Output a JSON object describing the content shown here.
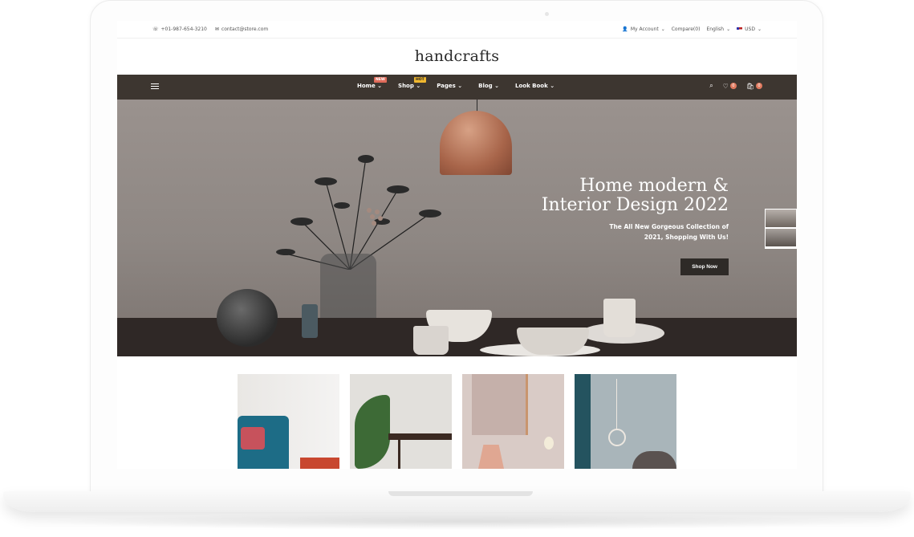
{
  "topbar": {
    "phone": "+01-987-654-3210",
    "email": "contact@store.com",
    "account": "My Account",
    "compare": "Compare(0)",
    "language": "English",
    "currency": "USD"
  },
  "logo": "handcrafts",
  "nav": {
    "items": [
      {
        "label": "Home",
        "badge": "NEW"
      },
      {
        "label": "Shop",
        "badge": "HOT"
      },
      {
        "label": "Pages",
        "badge": ""
      },
      {
        "label": "Blog",
        "badge": ""
      },
      {
        "label": "Look Book",
        "badge": ""
      }
    ],
    "wishlist_count": "0",
    "cart_count": "0"
  },
  "hero": {
    "title_line1": "Home modern &",
    "title_line2": "Interior Design 2022",
    "subtitle_line1": "The All New Gorgeous Collection of",
    "subtitle_line2": "2021, Shopping With Us!",
    "button": "Shop Now"
  },
  "icons": {
    "phone": "phone-icon",
    "email": "envelope-icon",
    "account": "user-icon",
    "menu": "hamburger-icon",
    "search": "search-icon",
    "wishlist": "heart-icon",
    "cart": "bag-icon"
  },
  "colors": {
    "nav_bg": "#3d3630",
    "badge_new": "#e06b5a",
    "badge_hot": "#f0b72f",
    "counter": "#e07a5f",
    "button_bg": "#2e2a27"
  }
}
